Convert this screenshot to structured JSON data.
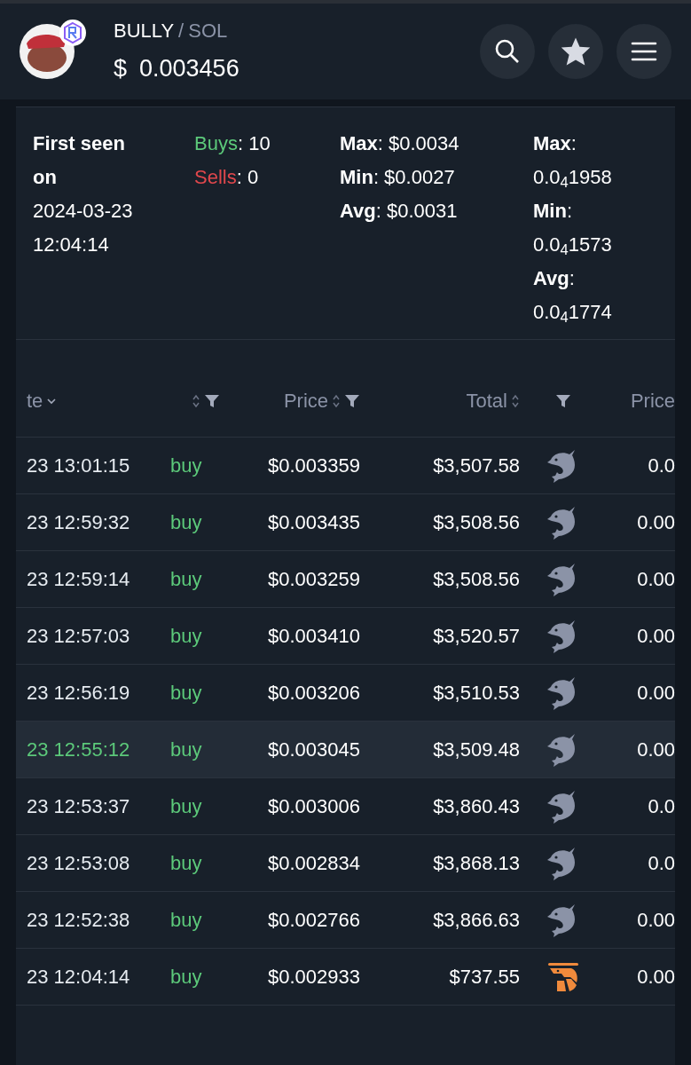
{
  "header": {
    "base": "BULLY",
    "separator": "/",
    "quote": "SOL",
    "currency": "$",
    "price": "0.003456"
  },
  "stats": {
    "first_seen": {
      "label": "First seen on",
      "date": "2024-03-23",
      "time": "12:04:14"
    },
    "counts": [
      {
        "label": "Buys",
        "value": ": 10",
        "color": "#5cc97a"
      },
      {
        "label": "Sells",
        "value": ": 0",
        "color": "#e0474c"
      }
    ],
    "usd": [
      {
        "label": "Max",
        "value": ": $0.0034"
      },
      {
        "label": "Min",
        "value": ": $0.0027"
      },
      {
        "label": "Avg",
        "value": ": $0.0031"
      }
    ],
    "native": [
      {
        "label": "Max",
        "colon": ":",
        "value": "0.0$_{4}$1958"
      },
      {
        "label": "Min",
        "colon": ":",
        "value": "0.0$_{4}$1573"
      },
      {
        "label": "Avg",
        "colon": ":",
        "value": "0.0$_{4}$1774"
      }
    ]
  },
  "table": {
    "columns": [
      {
        "label": "te",
        "sort": false,
        "chevron": true,
        "filter": false
      },
      {
        "sort": true,
        "chevron": false,
        "filter": true
      },
      {
        "label": "Price",
        "sort": true,
        "chevron": false,
        "filter": true
      },
      {
        "label": "Total",
        "sort": true,
        "chevron": false,
        "filter": false
      },
      {
        "sort": false,
        "chevron": false,
        "filter": true
      },
      {
        "label": "Price",
        "sort": false,
        "chevron": false,
        "filter": false
      }
    ],
    "rows": [
      {
        "date": "23 13:01:15",
        "type": "buy",
        "price": "$0.003359",
        "total": "$3,507.58",
        "kind": "dolphin",
        "column_6": "0.0",
        "highlighted": false
      },
      {
        "date": "23 12:59:32",
        "type": "buy",
        "price": "$0.003435",
        "total": "$3,508.56",
        "kind": "dolphin",
        "column_6": "0.00",
        "highlighted": false
      },
      {
        "date": "23 12:59:14",
        "type": "buy",
        "price": "$0.003259",
        "total": "$3,508.56",
        "kind": "dolphin",
        "column_6": "0.00",
        "highlighted": false
      },
      {
        "date": "23 12:57:03",
        "type": "buy",
        "price": "$0.003410",
        "total": "$3,520.57",
        "kind": "dolphin",
        "column_6": "0.00",
        "highlighted": false
      },
      {
        "date": "23 12:56:19",
        "type": "buy",
        "price": "$0.003206",
        "total": "$3,510.53",
        "kind": "dolphin",
        "column_6": "0.00",
        "highlighted": false
      },
      {
        "date": "23 12:55:12",
        "type": "buy",
        "price": "$0.003045",
        "total": "$3,509.48",
        "kind": "dolphin",
        "column_6": "0.00",
        "highlighted": true
      },
      {
        "date": "23 12:53:37",
        "type": "buy",
        "price": "$0.003006",
        "total": "$3,860.43",
        "kind": "dolphin",
        "column_6": "0.0",
        "highlighted": false
      },
      {
        "date": "23 12:53:08",
        "type": "buy",
        "price": "$0.002834",
        "total": "$3,868.13",
        "kind": "dolphin",
        "column_6": "0.0",
        "highlighted": false
      },
      {
        "date": "23 12:52:38",
        "type": "buy",
        "price": "$0.002766",
        "total": "$3,866.63",
        "kind": "dolphin",
        "column_6": "0.00",
        "highlighted": false
      },
      {
        "date": "23 12:04:14",
        "type": "buy",
        "price": "$0.002933",
        "total": "$737.55",
        "kind": "shrimp",
        "column_6": "0.00",
        "highlighted": false
      }
    ]
  }
}
